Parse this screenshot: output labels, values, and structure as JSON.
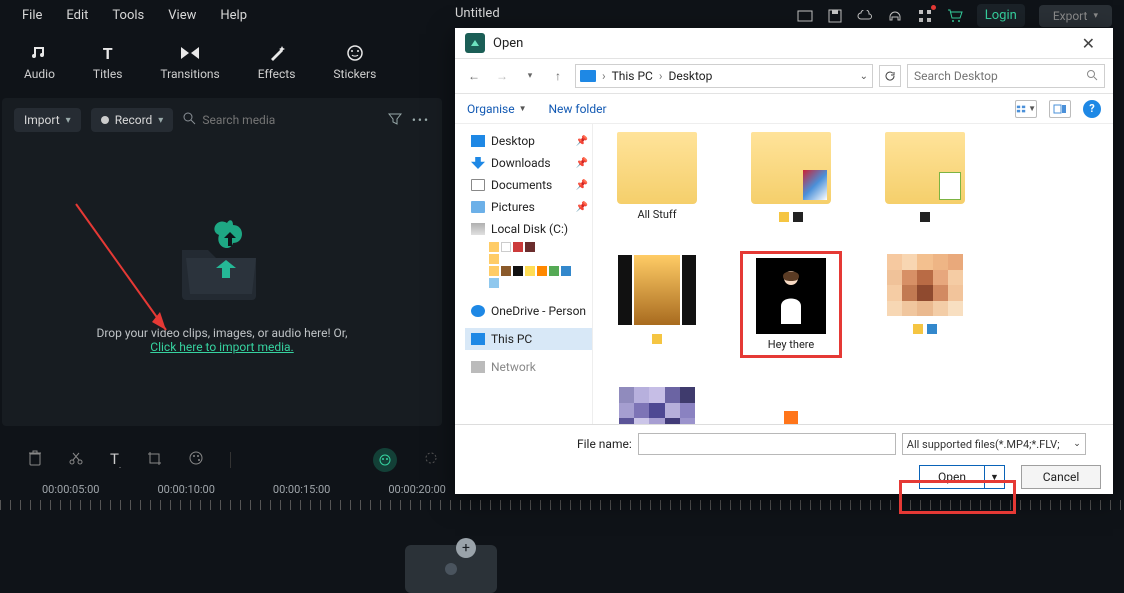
{
  "menubar": {
    "file": "File",
    "edit": "Edit",
    "tools": "Tools",
    "view": "View",
    "help": "Help"
  },
  "doc": {
    "title": "Untitled"
  },
  "topright": {
    "login": "Login",
    "export": "Export"
  },
  "tools": {
    "audio": "Audio",
    "titles": "Titles",
    "transitions": "Transitions",
    "effects": "Effects",
    "stickers": "Stickers"
  },
  "media": {
    "import": "Import",
    "record": "Record",
    "search_placeholder": "Search media",
    "drop_text": "Drop your video clips, images, or audio here! Or,",
    "import_link": "Click here to import media."
  },
  "timeline": {
    "labels": [
      "00:00:05:00",
      "00:00:10:00",
      "00:00:15:00",
      "00:00:20:00"
    ]
  },
  "dialog": {
    "title": "Open",
    "breadcrumb": {
      "pc": "This PC",
      "desktop": "Desktop"
    },
    "search_placeholder": "Search Desktop",
    "organise": "Organise",
    "new_folder": "New folder",
    "tree": {
      "desktop": "Desktop",
      "downloads": "Downloads",
      "documents": "Documents",
      "pictures": "Pictures",
      "localdisk": "Local Disk (C:)",
      "onedrive": "OneDrive - Person",
      "thispc": "This PC",
      "network": "Network"
    },
    "items": {
      "allstuff": "All Stuff",
      "heythere": "Hey there"
    },
    "filename_label": "File name:",
    "filter": "All supported files(*.MP4;*.FLV;",
    "open": "Open",
    "cancel": "Cancel"
  },
  "colors": {
    "accent": "#36d29f",
    "dark": "#171c21",
    "red": "#e53935"
  }
}
